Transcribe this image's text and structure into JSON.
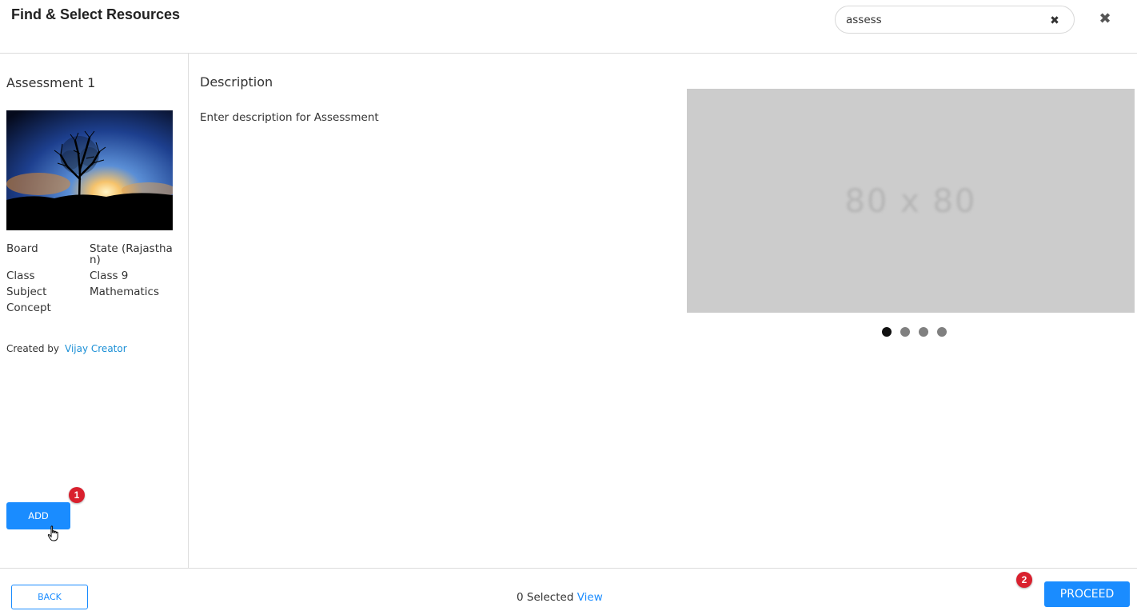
{
  "header": {
    "title": "Find & Select Resources",
    "search": {
      "value": "assess",
      "clear_icon": "clear-x-icon"
    },
    "close_icon": "close-x-icon"
  },
  "resource": {
    "title": "Assessment 1",
    "thumbnail": "tree-sunset-image",
    "meta": [
      {
        "label": "Board",
        "value": "State (Rajasthan)"
      },
      {
        "label": "Class",
        "value": "Class 9"
      },
      {
        "label": "Subject",
        "value": "Mathematics"
      },
      {
        "label": "Concept",
        "value": ""
      }
    ],
    "created_by_label": "Created by",
    "creator": "Vijay Creator",
    "add_label": "ADD",
    "add_badge": "1"
  },
  "description": {
    "heading": "Description",
    "text": "Enter description for Assessment"
  },
  "carousel": {
    "placeholder": "80 x 80",
    "slide_count": 4,
    "active_index": 0
  },
  "footer": {
    "back_label": "BACK",
    "selected_text": "0 Selected",
    "view_label": "View",
    "proceed_label": "PROCEED",
    "proceed_badge": "2"
  },
  "colors": {
    "accent": "#1a8cff",
    "badge": "#d9202e",
    "link": "#1a8fd6"
  }
}
